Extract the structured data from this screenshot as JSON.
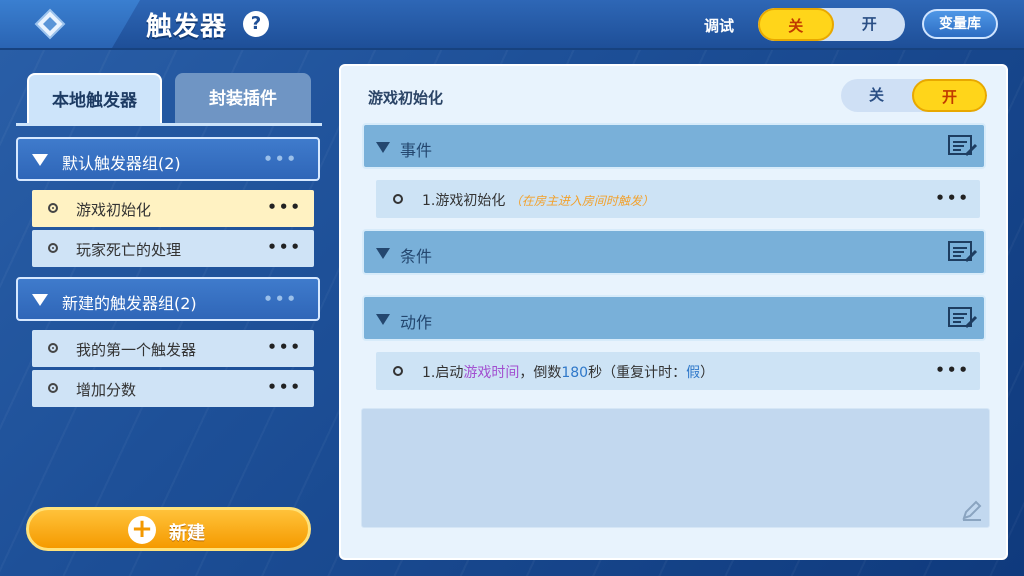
{
  "header": {
    "title": "触发器",
    "help": "?",
    "debug_label": "调试",
    "debug_off": "关",
    "debug_on": "开",
    "var_lib": "变量库"
  },
  "left": {
    "tabs": [
      {
        "label": "本地触发器"
      },
      {
        "label": "封装插件"
      }
    ],
    "groups": [
      {
        "label": "默认触发器组(2)",
        "items": [
          {
            "label": "游戏初始化"
          },
          {
            "label": "玩家死亡的处理"
          }
        ]
      },
      {
        "label": "新建的触发器组(2)",
        "items": [
          {
            "label": "我的第一个触发器"
          },
          {
            "label": "增加分数"
          }
        ]
      }
    ],
    "more": "•••",
    "new_button": "新建",
    "new_plus": "+"
  },
  "right": {
    "trigger_name": "游戏初始化",
    "toggle_off": "关",
    "toggle_on": "开",
    "sections": {
      "events": "事件",
      "conditions": "条件",
      "actions": "动作"
    },
    "event_row": {
      "text": "1.游戏初始化",
      "hint": "（在房主进入房间时触发）"
    },
    "action_row": {
      "p1": "1.启动",
      "p2": "游戏时间",
      "p3": "，倒数",
      "p4": "180",
      "p5": "秒（重复计时：",
      "p6": "假",
      "p7": "）"
    }
  },
  "colors": {
    "accent": "#ffd51a",
    "panel": "#e8f3fd",
    "section": "#79b0d9"
  }
}
